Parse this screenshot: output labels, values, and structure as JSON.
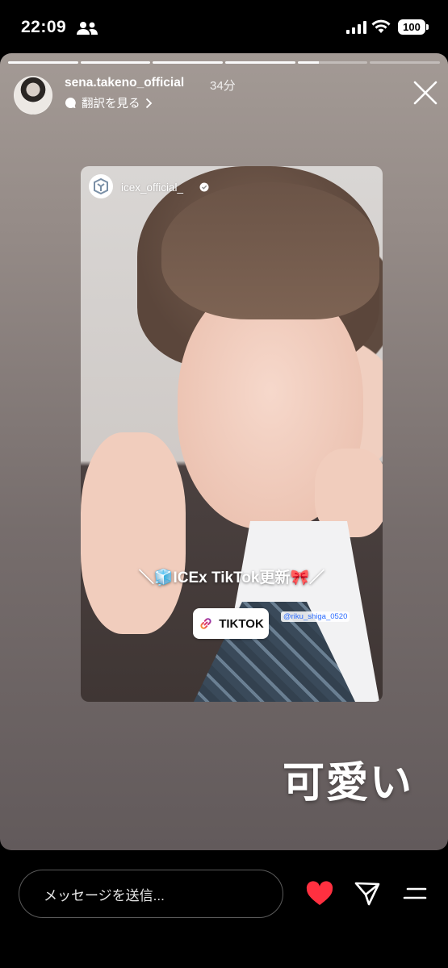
{
  "status_bar": {
    "time": "22:09",
    "battery": "100"
  },
  "story": {
    "username": "sena.takeno_official",
    "time_ago": "34分",
    "translate_label": "翻訳を見る",
    "progress": {
      "total_segments": 6,
      "completed": 4,
      "current_progress": 0.3
    }
  },
  "repost_card": {
    "username": "icex_official_",
    "banner_text": "＼🧊ICEx TikTok更新🎀／",
    "link_sticker_label": "TIKTOK",
    "mention": "@riku_shiga_0520"
  },
  "caption": "可愛い",
  "bottom_bar": {
    "message_placeholder": "メッセージを送信..."
  },
  "colors": {
    "like_red": "#ff3040"
  }
}
